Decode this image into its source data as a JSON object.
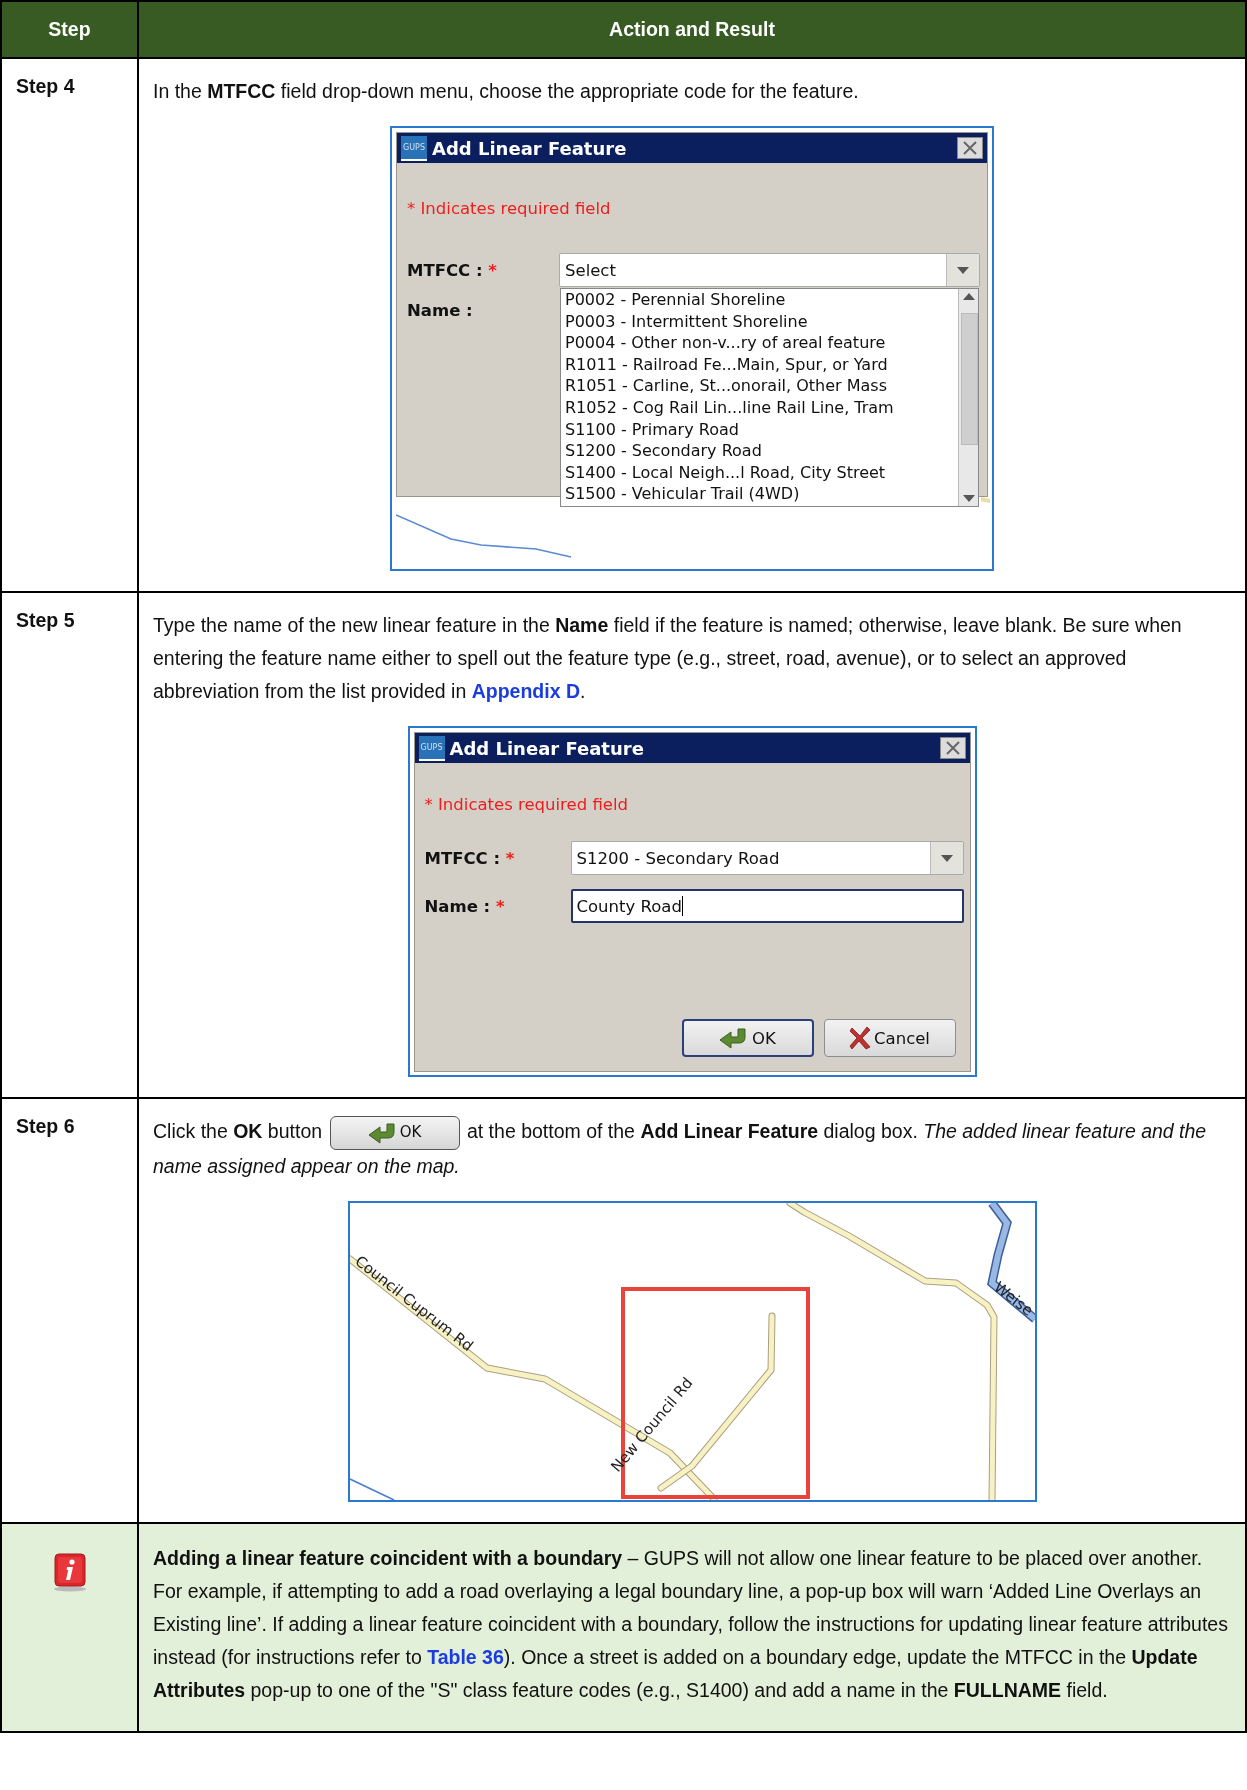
{
  "table": {
    "columns": [
      "Step",
      "Action and Result"
    ],
    "rows": [
      {
        "kind": "step",
        "step": "Step 4",
        "instruction": [
          {
            "text": "In the **MTFCC** field drop-down menu, choose the appropriate code for the feature."
          }
        ],
        "figure": {
          "kind": "dialog-over-map",
          "icon_text": "GUPS",
          "title": "Add Linear Feature",
          "required_note": "* Indicates required field",
          "fields": [
            {
              "kind": "combo",
              "label": "MTFCC :",
              "mark": "*",
              "value": "Select"
            },
            {
              "kind": "text",
              "label": "Name :",
              "focused": false
            }
          ],
          "dropdown": [
            "P0002 - Perennial Shoreline",
            "P0003 - Intermittent Shoreline",
            "P0004 - Other non-v...ry of areal feature",
            "R1011 - Railroad Fe...Main, Spur, or Yard",
            "R1051 - Carline, St...onorail, Other Mass",
            "R1052 - Cog Rail Lin...line Rail Line, Tram",
            "S1100 - Primary Road",
            "S1200 - Secondary Road",
            "S1400 - Local Neigh...l Road, City Street",
            "S1500 - Vehicular Trail (4WD)"
          ]
        }
      },
      {
        "kind": "step",
        "step": "Step 5",
        "instruction": [
          {
            "text": "Type the name of the new linear feature in the **Name** field if the feature is named; otherwise, leave blank. Be sure when entering the feature name either to spell out the feature type (e.g., street, road, avenue), or to select an approved abbreviation from the list provided in "
          },
          {
            "kind": "link",
            "text": "Appendix D"
          },
          {
            "text": "."
          }
        ],
        "figure": {
          "kind": "dialog",
          "icon_text": "GUPS",
          "title": "Add Linear Feature",
          "required_note": "* Indicates required field",
          "fields": [
            {
              "kind": "combo",
              "label": "MTFCC :",
              "mark": "*",
              "value": "S1200 - Secondary Road"
            },
            {
              "kind": "text",
              "label": "Name :",
              "mark": "*",
              "value": "County Road",
              "focused": true
            }
          ],
          "buttons": [
            {
              "kind": "ok",
              "label": "OK"
            },
            {
              "kind": "cancel",
              "label": "Cancel"
            }
          ]
        }
      },
      {
        "kind": "step",
        "step": "Step 6",
        "instruction": [
          {
            "text": "Click the **OK** button "
          },
          {
            "kind": "button",
            "text": "OK"
          },
          {
            "text": " at the bottom of the **Add Linear Feature** dialog box. *The added linear feature and the name assigned appear on the map.*"
          }
        ],
        "figure": {
          "kind": "map",
          "labels": [
            "Council Cuprum Rd",
            "New Council Rd",
            "Weise"
          ]
        }
      },
      {
        "kind": "note",
        "instruction": [
          {
            "text": "**Adding a linear feature coincident with a boundary** – GUPS will not allow one linear feature to be placed over another. For example, if attempting to add a road overlaying a legal boundary line, a pop-up box will warn ‘Added Line Overlays an Existing line’. If adding a linear feature coincident with a boundary, follow the instructions for updating linear feature attributes instead (for instructions refer to "
          },
          {
            "kind": "link",
            "text": "Table 36"
          },
          {
            "text": "). Once a street is added on a boundary edge, update the MTFCC in the **Update Attributes** pop-up to one of the \"S\" class feature codes (e.g., S1400) and add a name in the **FULLNAME** field."
          }
        ]
      }
    ]
  }
}
